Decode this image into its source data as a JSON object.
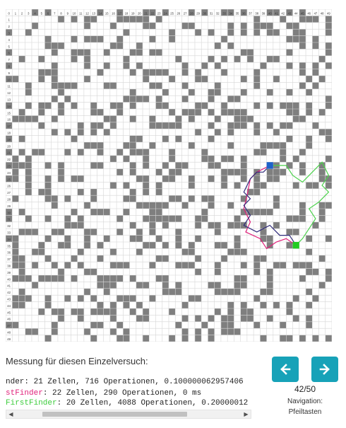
{
  "grid": {
    "columns": 50,
    "rows": 50,
    "column_labels": [
      "0",
      "1",
      "2",
      "3",
      "4",
      "5",
      "6",
      "7",
      "8",
      "9",
      "10",
      "11",
      "12",
      "13",
      "14",
      "15",
      "16",
      "17",
      "18",
      "19",
      "20",
      "21",
      "22",
      "23",
      "24",
      "25",
      "26",
      "27",
      "28",
      "29",
      "30",
      "31",
      "32",
      "33",
      "34",
      "35",
      "36",
      "37",
      "38",
      "39",
      "40",
      "41",
      "42",
      "43",
      "44",
      "45",
      "46",
      "47",
      "48",
      "49"
    ],
    "row_labels": [
      "0",
      "1",
      "2",
      "3",
      "4",
      "5",
      "6",
      "7",
      "8",
      "9",
      "10",
      "11",
      "12",
      "13",
      "14",
      "15",
      "16",
      "17",
      "18",
      "19",
      "20",
      "21",
      "22",
      "23",
      "24",
      "25",
      "26",
      "27",
      "28",
      "29",
      "30",
      "31",
      "32",
      "33",
      "34",
      "35",
      "36",
      "37",
      "38",
      "39",
      "40",
      "41",
      "42",
      "43",
      "44",
      "45",
      "46",
      "47",
      "48",
      "49"
    ],
    "colors": {
      "wall": "#7f7f7f",
      "line": "#d6d6d6",
      "start": "#1e62c8",
      "goal": "#22cc22",
      "path_a": "#2f2a7a",
      "path_b": "#e0207a",
      "path_c": "#4cd24c"
    },
    "start_cell": [
      40,
      23
    ],
    "goal_cell": [
      44,
      35
    ]
  },
  "measure": {
    "title": "Messung für diesen Einzelversuch:"
  },
  "results": [
    {
      "name": "nder",
      "text": ": 21 Zellen, 716 Operationen, 0.100000062957406",
      "color": "#222222"
    },
    {
      "name": "stFinder",
      "text": ": 22 Zellen, 290 Operationen, 0 ms",
      "color": "#e0207a"
    },
    {
      "name": "FirstFinder",
      "text": ": 20 Zellen, 4088 Operationen, 0.20000012",
      "color": "#3ccc3c"
    }
  ],
  "nav": {
    "counter": "42/50",
    "label_line1": "Navigation:",
    "label_line2": "Pfeiltasten",
    "prev_icon": "arrow-left-icon",
    "next_icon": "arrow-right-icon"
  },
  "scrollbar": {
    "left_icon": "◀",
    "right_icon": "▶"
  }
}
